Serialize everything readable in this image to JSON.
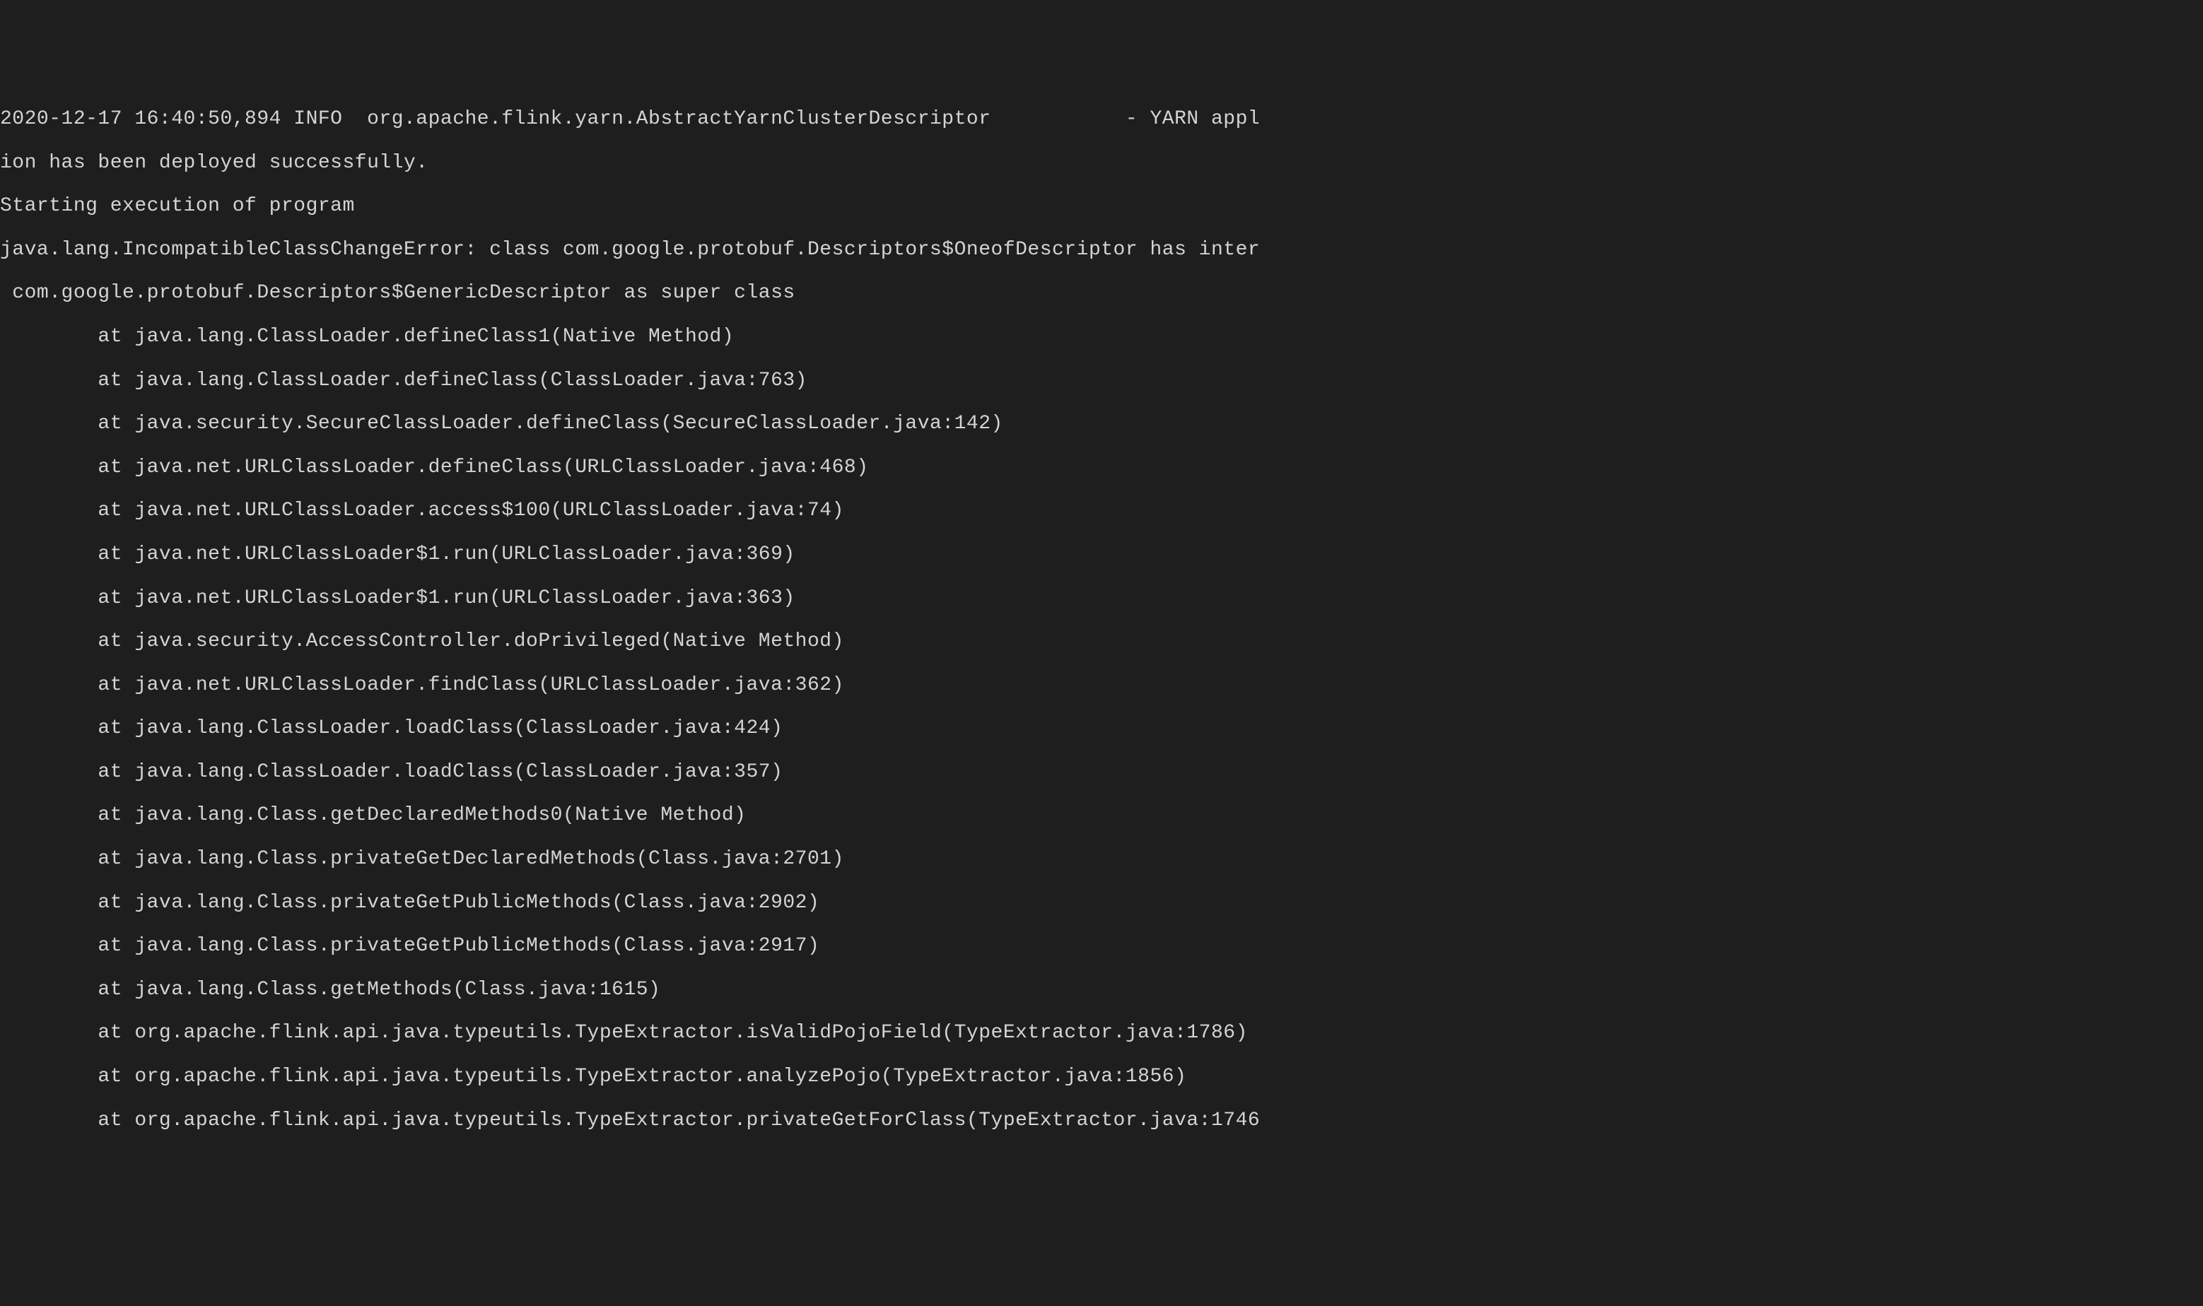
{
  "terminal": {
    "lines": [
      "2020-12-17 16:40:50,894 INFO  org.apache.flink.yarn.AbstractYarnClusterDescriptor           - YARN appl",
      "ion has been deployed successfully.",
      "Starting execution of program",
      "java.lang.IncompatibleClassChangeError: class com.google.protobuf.Descriptors$OneofDescriptor has inter",
      " com.google.protobuf.Descriptors$GenericDescriptor as super class",
      "        at java.lang.ClassLoader.defineClass1(Native Method)",
      "        at java.lang.ClassLoader.defineClass(ClassLoader.java:763)",
      "        at java.security.SecureClassLoader.defineClass(SecureClassLoader.java:142)",
      "        at java.net.URLClassLoader.defineClass(URLClassLoader.java:468)",
      "        at java.net.URLClassLoader.access$100(URLClassLoader.java:74)",
      "        at java.net.URLClassLoader$1.run(URLClassLoader.java:369)",
      "        at java.net.URLClassLoader$1.run(URLClassLoader.java:363)",
      "        at java.security.AccessController.doPrivileged(Native Method)",
      "        at java.net.URLClassLoader.findClass(URLClassLoader.java:362)",
      "        at java.lang.ClassLoader.loadClass(ClassLoader.java:424)",
      "        at java.lang.ClassLoader.loadClass(ClassLoader.java:357)",
      "        at java.lang.Class.getDeclaredMethods0(Native Method)",
      "        at java.lang.Class.privateGetDeclaredMethods(Class.java:2701)",
      "        at java.lang.Class.privateGetPublicMethods(Class.java:2902)",
      "        at java.lang.Class.privateGetPublicMethods(Class.java:2917)",
      "        at java.lang.Class.getMethods(Class.java:1615)",
      "        at org.apache.flink.api.java.typeutils.TypeExtractor.isValidPojoField(TypeExtractor.java:1786)",
      "        at org.apache.flink.api.java.typeutils.TypeExtractor.analyzePojo(TypeExtractor.java:1856)",
      "        at org.apache.flink.api.java.typeutils.TypeExtractor.privateGetForClass(TypeExtractor.java:1746"
    ]
  },
  "watermark": ""
}
